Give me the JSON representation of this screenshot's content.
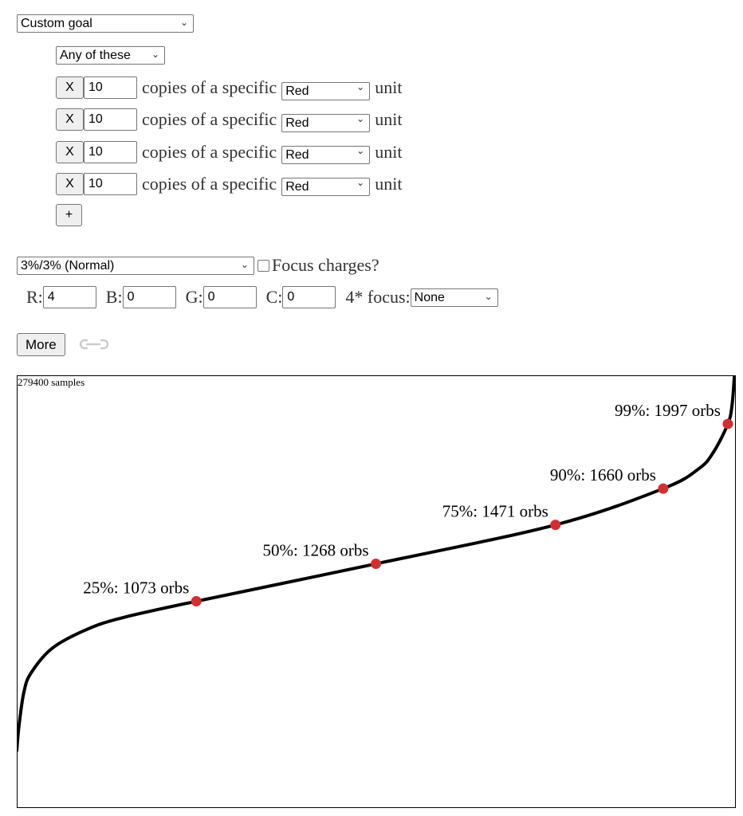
{
  "goal_select": "Custom goal",
  "mode_select": "Any of these",
  "rows": [
    {
      "remove": "X",
      "count": "10",
      "text": "copies of a specific",
      "color": "Red",
      "suffix": "unit"
    },
    {
      "remove": "X",
      "count": "10",
      "text": "copies of a specific",
      "color": "Red",
      "suffix": "unit"
    },
    {
      "remove": "X",
      "count": "10",
      "text": "copies of a specific",
      "color": "Red",
      "suffix": "unit"
    },
    {
      "remove": "X",
      "count": "10",
      "text": "copies of a specific",
      "color": "Red",
      "suffix": "unit"
    }
  ],
  "add_label": "+",
  "rate_select": "3%/3% (Normal)",
  "focus_charges_label": "Focus charges?",
  "focus_charges_checked": false,
  "counts": [
    {
      "label": "R:",
      "value": "4"
    },
    {
      "label": "B:",
      "value": "0"
    },
    {
      "label": "G:",
      "value": "0"
    },
    {
      "label": "C:",
      "value": "0"
    }
  ],
  "focus4_label": "4* focus:",
  "focus4_select": "None",
  "more_label": "More",
  "link_icon": "link-icon",
  "chart_data": {
    "type": "line",
    "samples_label": "279400 samples",
    "x_unit": "percentile",
    "y_unit": "orbs",
    "xlim": [
      0,
      100
    ],
    "ylim": [
      0,
      2250
    ],
    "line_color": "#000000",
    "marker_color": "#d32f2f",
    "curve": [
      [
        0,
        290
      ],
      [
        0.3,
        420
      ],
      [
        1,
        600
      ],
      [
        2,
        700
      ],
      [
        5,
        830
      ],
      [
        10,
        930
      ],
      [
        15,
        990
      ],
      [
        25,
        1073
      ],
      [
        50,
        1268
      ],
      [
        75,
        1471
      ],
      [
        90,
        1660
      ],
      [
        95,
        1765
      ],
      [
        97,
        1850
      ],
      [
        99,
        1997
      ],
      [
        99.6,
        2100
      ],
      [
        100,
        2300
      ]
    ],
    "markers": [
      {
        "p": 25,
        "orbs": 1073,
        "label": "25%: 1073 orbs"
      },
      {
        "p": 50,
        "orbs": 1268,
        "label": "50%: 1268 orbs"
      },
      {
        "p": 75,
        "orbs": 1471,
        "label": "75%: 1471 orbs"
      },
      {
        "p": 90,
        "orbs": 1660,
        "label": "90%: 1660 orbs"
      },
      {
        "p": 99,
        "orbs": 1997,
        "label": "99%: 1997 orbs"
      }
    ]
  }
}
